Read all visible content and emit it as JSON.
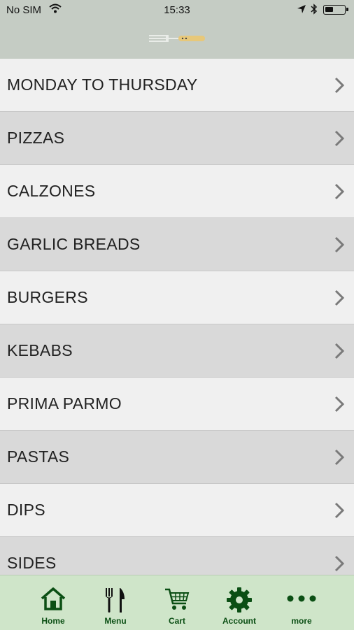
{
  "status_bar": {
    "carrier": "No SIM",
    "time": "15:33"
  },
  "menu": {
    "items": [
      {
        "label": "MONDAY TO THURSDAY"
      },
      {
        "label": "PIZZAS"
      },
      {
        "label": "CALZONES"
      },
      {
        "label": "GARLIC BREADS"
      },
      {
        "label": "BURGERS"
      },
      {
        "label": "KEBABS"
      },
      {
        "label": "PRIMA PARMO"
      },
      {
        "label": "PASTAS"
      },
      {
        "label": "DIPS"
      },
      {
        "label": "SIDES"
      }
    ]
  },
  "tabbar": {
    "tabs": [
      {
        "label": "Home",
        "icon": "home-icon"
      },
      {
        "label": "Menu",
        "icon": "fork-knife-icon"
      },
      {
        "label": "Cart",
        "icon": "cart-icon"
      },
      {
        "label": "Account",
        "icon": "gear-icon"
      },
      {
        "label": "more",
        "icon": "more-dots-icon"
      }
    ]
  },
  "colors": {
    "header_bg": "#c5ccc4",
    "row_light": "#f0f0f0",
    "row_dark": "#d9d9d9",
    "tabbar_bg": "#cfe5c9",
    "tab_accent": "#0b4f14"
  }
}
